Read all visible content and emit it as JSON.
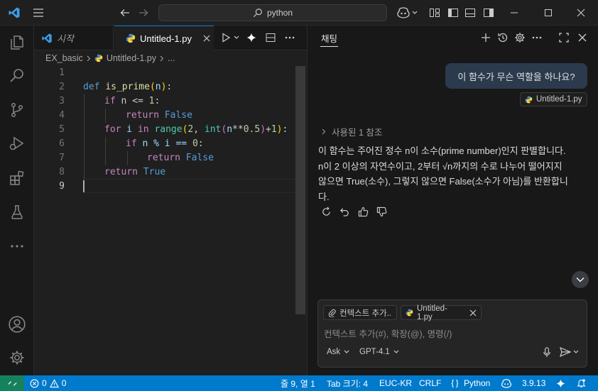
{
  "titlebar": {
    "search_text": "python",
    "icons": [
      "vscode-logo-icon",
      "menu-icon",
      "back-icon",
      "forward-icon",
      "search-icon",
      "copilot-icon",
      "layout-icon",
      "toggle-sidebar-icon",
      "toggle-panel-icon",
      "toggle-secondary-sidebar-icon",
      "minimize-icon",
      "maximize-icon",
      "close-icon"
    ]
  },
  "activity": {
    "items": [
      "explorer-icon",
      "search-icon",
      "source-control-icon",
      "run-debug-icon",
      "extensions-icon",
      "testing-icon",
      "more-icon",
      "account-icon",
      "settings-icon"
    ]
  },
  "editor": {
    "tabs": [
      {
        "label": "시작",
        "icon": "vscode-logo-icon"
      },
      {
        "label": "Untitled-1.py",
        "icon": "python-icon"
      }
    ],
    "breadcrumb": {
      "folder": "EX_basic",
      "file": "Untitled-1.py",
      "more": "..."
    },
    "line_numbers": [
      "1",
      "2",
      "3",
      "4",
      "5",
      "6",
      "7",
      "8",
      "9"
    ],
    "code": {
      "l2_def": "def",
      "l2_name": "is_prime",
      "l2_open": "(",
      "l2_param": "n",
      "l2_close": ")",
      "l2_colon": ":",
      "l3_if": "if",
      "l3_rest": " n <= ",
      "l3_num": "1",
      "l3_colon": ":",
      "l4_return": "return",
      "l4_val": "False",
      "l5_for": "for",
      "l5_i": " i ",
      "l5_in": "in",
      "l5_range": "range",
      "l5_a": "(",
      "l5_two": "2",
      "l5_comma": ", ",
      "l5_int": "int",
      "l5_b": "(",
      "l5_n": "n",
      "l5_pow": "**",
      "l5_half": "0.5",
      "l5_c": ")",
      "l5_plus": "+",
      "l5_one": "1",
      "l5_d": ")",
      "l5_colon": ":",
      "l6_if": "if",
      "l6_rest": " n % i == ",
      "l6_zero": "0",
      "l6_colon": ":",
      "l7_return": "return",
      "l7_val": "False",
      "l8_return": "return",
      "l8_val": "True"
    }
  },
  "chat": {
    "tab_label": "채팅",
    "question": "이 함수가 무슨 역할을 하나요?",
    "attached_file": "Untitled-1.py",
    "references": "사용된 1 참조",
    "answer_lines": [
      "이 함수는 주어진 정수 n이 소수(prime number)인지 판별합니다.",
      "n이 2 이상의 자연수이고, 2부터 √n까지의 수로 나누어 떨어지지",
      "않으면 True(소수), 그렇지 않으면 False(소수가 아님)를 반환합니",
      "다."
    ],
    "input": {
      "context_chip": "컨텍스트 추가...",
      "file_chip": "Untitled-1.py",
      "placeholder": "컨텍스트 추가(#), 확장(@), 명령(/)",
      "mode": "Ask",
      "model": "GPT-4.1"
    }
  },
  "status": {
    "errors": "0",
    "warnings": "0",
    "position": "줄 9, 열 1",
    "tab_size": "Tab 크기: 4",
    "encoding": "EUC-KR",
    "eol": "CRLF",
    "language": "Python",
    "python_version": "3.9.13"
  },
  "colors": {
    "accent": "#007acc",
    "bubble": "#2c3a4d",
    "python_blue": "#4b8bbe",
    "python_yellow": "#ffd43b"
  }
}
